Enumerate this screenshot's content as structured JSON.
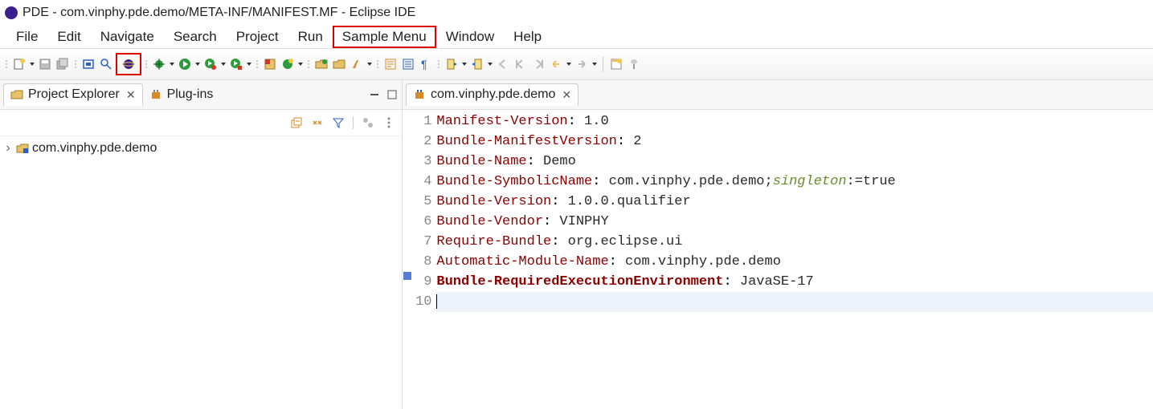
{
  "title": "PDE - com.vinphy.pde.demo/META-INF/MANIFEST.MF - Eclipse IDE",
  "menu": {
    "file": "File",
    "edit": "Edit",
    "navigate": "Navigate",
    "search": "Search",
    "project": "Project",
    "run": "Run",
    "sample": "Sample Menu",
    "window": "Window",
    "help": "Help"
  },
  "explorer": {
    "tab1": "Project Explorer",
    "tab2": "Plug-ins",
    "node1": "com.vinphy.pde.demo"
  },
  "editor": {
    "tab": "com.vinphy.pde.demo",
    "lines": {
      "1": "1",
      "2": "2",
      "3": "3",
      "4": "4",
      "5": "5",
      "6": "6",
      "7": "7",
      "8": "8",
      "9": "9",
      "10": "10"
    },
    "l1k": "Manifest-Version",
    "l1v": " 1.0",
    "l2k": "Bundle-ManifestVersion",
    "l2v": " 2",
    "l3k": "Bundle-Name",
    "l3v": " Demo",
    "l4k": "Bundle-SymbolicName",
    "l4v": " com.vinphy.pde.demo;",
    "l4d": "singleton",
    "l4e": ":=true",
    "l5k": "Bundle-Version",
    "l5v": " 1.0.0.qualifier",
    "l6k": "Bundle-Vendor",
    "l6v": " VINPHY",
    "l7k": "Require-Bundle",
    "l7v": " org.eclipse.ui",
    "l8k": "Automatic-Module-Name",
    "l8v": " com.vinphy.pde.demo",
    "l9k": "Bundle-RequiredExecutionEnvironment",
    "l9v": " JavaSE-17"
  },
  "colon": ":"
}
